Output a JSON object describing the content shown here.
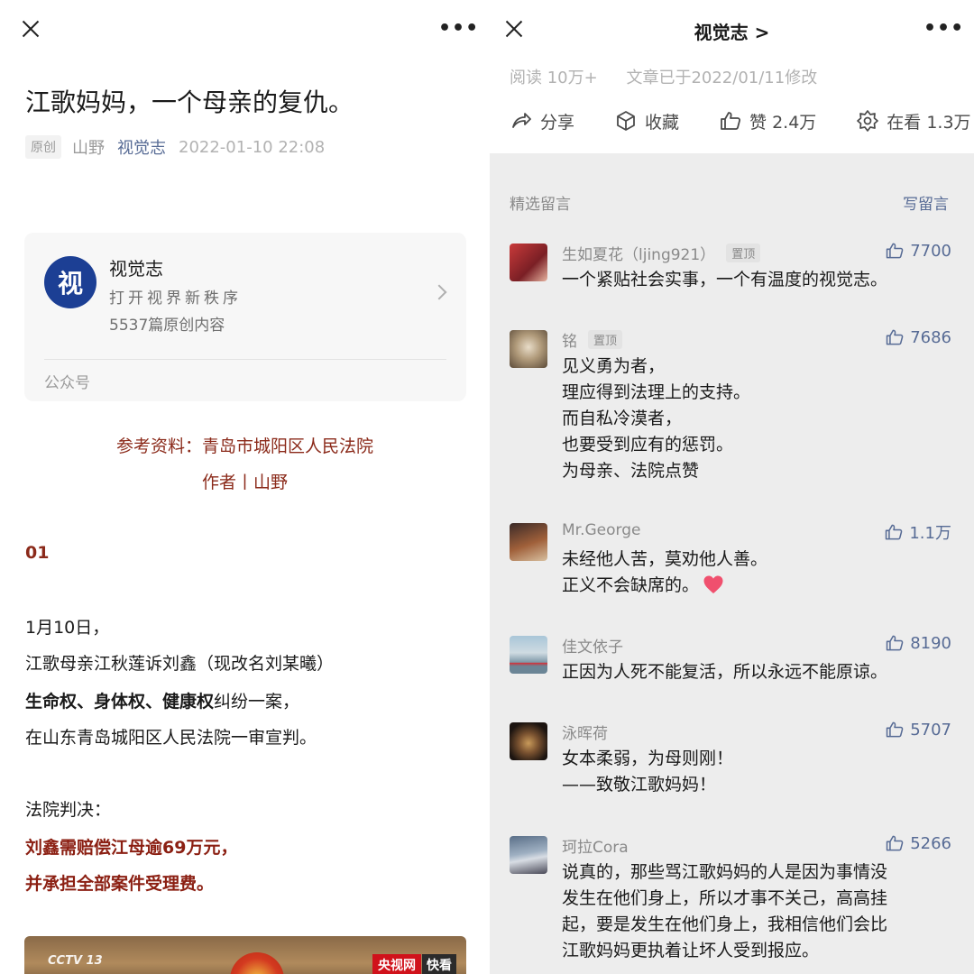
{
  "left": {
    "article_title": "江歌妈妈，一个母亲的复仇。",
    "meta": {
      "original_tag": "原创",
      "author": "山野",
      "account": "视觉志",
      "date": "2022-01-10 22:08"
    },
    "account_card": {
      "logo_char": "视",
      "name": "视觉志",
      "slogan": "打开视界新秩序",
      "article_count": "5537篇原创内容",
      "footer": "公众号"
    },
    "reference": "参考资料：青岛市城阳区人民法院",
    "author_line": "作者丨山野",
    "section_number": "01",
    "body": {
      "line1": "1月10日，",
      "line2": "江歌母亲江秋莲诉刘鑫（现改名刘某曦）",
      "line3_bold": "生命权、身体权、健康权",
      "line3_rest": "纠纷一案，",
      "line4": "在山东青岛城阳区人民法院一审宣判。",
      "line5": "法院判决：",
      "line6": "刘鑫需赔偿江母逾69万元，",
      "line7": "并承担全部案件受理费。"
    },
    "video": {
      "channel": "CCTV 13",
      "badge": "央视网",
      "badge2": "快看"
    }
  },
  "right": {
    "account_title": "视觉志 >",
    "read_count": "阅读 10万+",
    "modified": "文章已于2022/01/11修改",
    "actions": {
      "share": "分享",
      "collect": "收藏",
      "like": "赞 2.4万",
      "watching": "在看 1.3万"
    },
    "comments_label": "精选留言",
    "write_comment": "写留言",
    "comments": [
      {
        "name": "生如夏花（ljing921）",
        "pinned": "置顶",
        "likes": "7700",
        "lines": [
          "一个紧贴社会实事，一个有温度的视觉志。"
        ]
      },
      {
        "name": "铭",
        "pinned": "置顶",
        "likes": "7686",
        "lines": [
          "见义勇为者，",
          "理应得到法理上的支持。",
          "而自私冷漠者，",
          "也要受到应有的惩罚。",
          "为母亲、法院点赞"
        ]
      },
      {
        "name": "Mr.George",
        "pinned": "",
        "likes": "1.1万",
        "lines": [
          "未经他人苦，莫劝他人善。",
          "正义不会缺席的。"
        ]
      },
      {
        "name": "佳文依子",
        "pinned": "",
        "likes": "8190",
        "lines": [
          "正因为人死不能复活，所以永远不能原谅。"
        ]
      },
      {
        "name": "泳晖荷",
        "pinned": "",
        "likes": "5707",
        "lines": [
          "女本柔弱，为母则刚！",
          "——致敬江歌妈妈！"
        ]
      },
      {
        "name": "珂拉Cora",
        "pinned": "",
        "likes": "5266",
        "lines": [
          "说真的，那些骂江歌妈妈的人是因为事情没",
          "发生在他们身上，所以才事不关己，高高挂",
          "起，要是发生在他们身上，我相信他们会比",
          "江歌妈妈更执着让坏人受到报应。"
        ]
      }
    ]
  },
  "colors": {
    "link_blue": "#576b95",
    "article_red": "#8b2a1a",
    "logo_blue": "#1c3f94",
    "heart_pink": "#f0506e"
  }
}
